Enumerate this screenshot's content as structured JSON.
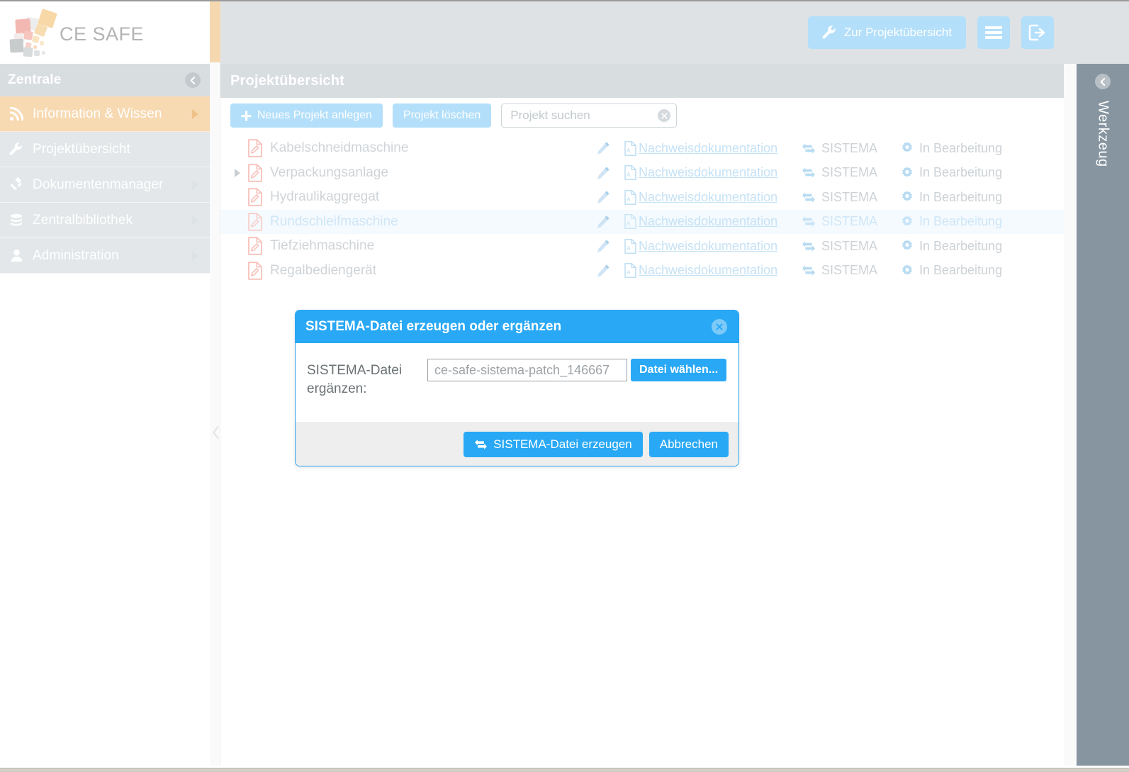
{
  "brand": {
    "name": "CE SAFE",
    "logo_colors": [
      "#f3bcb5",
      "#e8eaea",
      "#f6d9a8",
      "#c9cccd",
      "#f0a8a0"
    ]
  },
  "sidebar": {
    "header_title": "Zentrale",
    "collapse_icon": "chevron-left-circle-icon",
    "items": [
      {
        "label": "Information & Wissen",
        "icon": "rss-icon",
        "active": true,
        "has_arrow": true
      },
      {
        "label": "Projektübersicht",
        "icon": "wrench-icon",
        "active": false,
        "has_arrow": false
      },
      {
        "label": "Dokumentenmanager",
        "icon": "gavel-icon",
        "active": false,
        "has_arrow": true
      },
      {
        "label": "Zentralbibliothek",
        "icon": "database-icon",
        "active": false,
        "has_arrow": true
      },
      {
        "label": "Administration",
        "icon": "user-icon",
        "active": false,
        "has_arrow": true
      }
    ],
    "collapse_handle_icon": "chevron-left-icon"
  },
  "header": {
    "project_overview_button": "Zur Projektübersicht",
    "project_overview_icon": "wrench-icon",
    "menu_icon": "hamburger-menu-icon",
    "logout_icon": "logout-icon"
  },
  "page": {
    "title": "Projektübersicht"
  },
  "toolbar": {
    "new_project_label": "Neues Projekt anlegen",
    "new_project_icon": "plus-icon",
    "delete_project_label": "Projekt löschen",
    "search_placeholder": "Projekt suchen",
    "search_value": "",
    "search_clear_icon": "clear-circle-icon"
  },
  "table": {
    "doc_link_label": "Nachweisdokumentation",
    "doc_icon": "pdf-file-icon",
    "sistema_label": "SISTEMA",
    "sistema_icon": "sistema-exchange-icon",
    "status_label": "In Bearbeitung",
    "status_icon": "gear-icon",
    "edit_icon": "pencil-icon",
    "project_icon": "project-document-icon",
    "expand_icon": "triangle-right-icon",
    "rows": [
      {
        "name": "Kabelschneidmaschine",
        "expandable": false,
        "selected": false,
        "doc": "Nachweisdokumentation",
        "sistema": "SISTEMA",
        "status": "In Bearbeitung"
      },
      {
        "name": "Verpackungsanlage",
        "expandable": true,
        "selected": false,
        "doc": "Nachweisdokumentation",
        "sistema": "SISTEMA",
        "status": "In Bearbeitung"
      },
      {
        "name": "Hydraulikaggregat",
        "expandable": false,
        "selected": false,
        "doc": "Nachweisdokumentation",
        "sistema": "SISTEMA",
        "status": "In Bearbeitung"
      },
      {
        "name": "Rundschleifmaschine",
        "expandable": false,
        "selected": true,
        "doc": "Nachweisdokumentation",
        "sistema": "SISTEMA",
        "status": "In Bearbeitung"
      },
      {
        "name": "Tiefziehmaschine",
        "expandable": false,
        "selected": false,
        "doc": "Nachweisdokumentation",
        "sistema": "SISTEMA",
        "status": "In Bearbeitung"
      },
      {
        "name": "Regalbediengerät",
        "expandable": false,
        "selected": false,
        "doc": "Nachweisdokumentation",
        "sistema": "SISTEMA",
        "status": "In Bearbeitung"
      }
    ]
  },
  "right_panel": {
    "label": "Werkzeug",
    "collapse_icon": "chevron-left-circle-icon"
  },
  "modal": {
    "title": "SISTEMA-Datei erzeugen oder ergänzen",
    "close_icon": "close-circle-icon",
    "field_label": "SISTEMA-Datei ergänzen:",
    "file_value": "ce-safe-sistema-patch_146667",
    "choose_button": "Datei wählen...",
    "submit_button": "SISTEMA-Datei erzeugen",
    "submit_icon": "sistema-exchange-icon",
    "cancel_button": "Abbrechen"
  },
  "colors": {
    "accent_blue": "#29a8f5",
    "light_blue": "#b3dffa",
    "header_grey": "#dee2e5",
    "sidebar_grey": "#e3e7e9",
    "active_orange": "#f7d9b2",
    "panel_slate": "#8695a0"
  }
}
